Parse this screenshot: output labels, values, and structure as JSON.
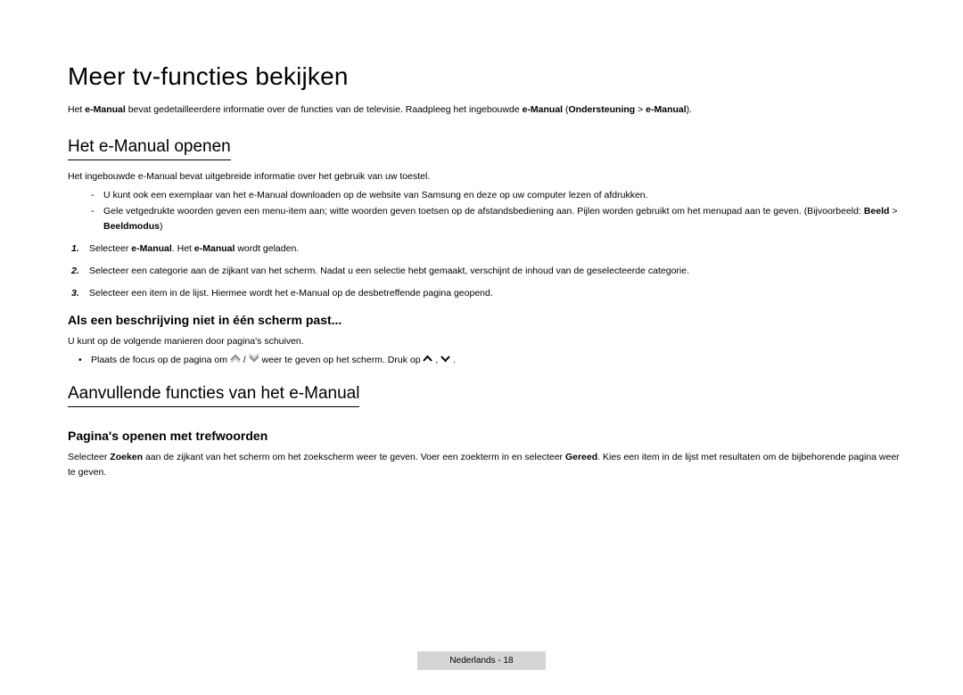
{
  "title": "Meer tv-functies bekijken",
  "intro": {
    "t1": "Het ",
    "b1": "e-Manual",
    "t2": " bevat gedetailleerdere informatie over de functies van de televisie. Raadpleeg het ingebouwde ",
    "b2": "e-Manual",
    "t3": " (",
    "b3": "Ondersteuning",
    "t4": " > ",
    "b4": "e-Manual",
    "t5": ")."
  },
  "sec1": {
    "heading": "Het e-Manual openen",
    "p1": "Het ingebouwde e-Manual bevat uitgebreide informatie over het gebruik van uw toestel.",
    "dash1": "U kunt ook een exemplaar van het e-Manual downloaden op de website van Samsung en deze op uw computer lezen of afdrukken.",
    "dash2_t1": "Gele vetgedrukte woorden geven een menu-item aan; witte woorden geven toetsen op de afstandsbediening aan. Pijlen worden gebruikt om het menupad aan te geven. (Bijvoorbeeld: ",
    "dash2_b1": "Beeld",
    "dash2_t2": " > ",
    "dash2_b2": "Beeldmodus",
    "dash2_t3": ")",
    "ol1_t1": "Selecteer ",
    "ol1_b1": "e-Manual",
    "ol1_t2": ". Het ",
    "ol1_b2": "e-Manual",
    "ol1_t3": " wordt geladen.",
    "ol2": "Selecteer een categorie aan de zijkant van het scherm. Nadat u een selectie hebt gemaakt, verschijnt de inhoud van de geselecteerde categorie.",
    "ol3": "Selecteer een item in de lijst. Hiermee wordt het e-Manual op de desbetreffende pagina geopend.",
    "sub_h": "Als een beschrijving niet in één scherm past...",
    "sub_p": "U kunt op de volgende manieren door pagina's schuiven.",
    "bullet_t1": "Plaats de focus op de pagina om ",
    "bullet_t2": " / ",
    "bullet_t3": " weer te geven op het scherm. Druk op ",
    "bullet_t4": ", ",
    "bullet_t5": "."
  },
  "sec2": {
    "heading": "Aanvullende functies van het e-Manual",
    "sub_h": "Pagina's openen met trefwoorden",
    "p_t1": "Selecteer ",
    "p_b1": "Zoeken",
    "p_t2": " aan de zijkant van het scherm om het zoekscherm weer te geven. Voer een zoekterm in en selecteer ",
    "p_b2": "Gereed",
    "p_t3": ". Kies een item in de lijst met resultaten om de bijbehorende pagina weer te geven."
  },
  "footer": "Nederlands - 18"
}
